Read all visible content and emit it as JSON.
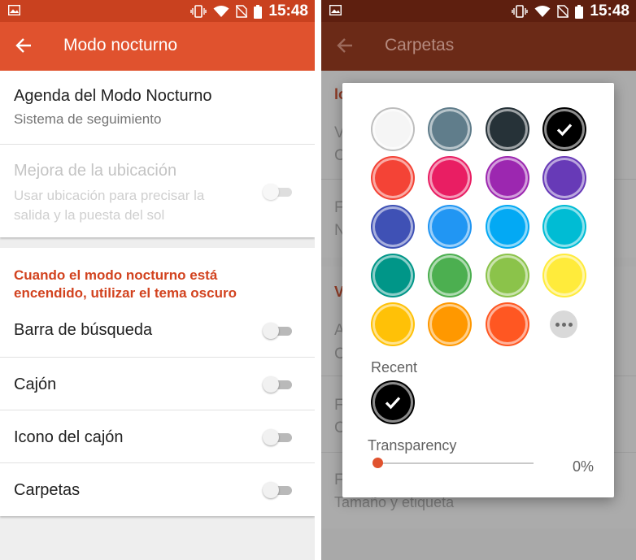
{
  "status_bar": {
    "time": "15:48"
  },
  "left_screen": {
    "title": "Modo nocturno",
    "schedule": {
      "title": "Agenda del Modo Nocturno",
      "subtitle": "Sistema de seguimiento"
    },
    "location": {
      "title": "Mejora de la ubicación",
      "subtitle_line1": "Usar ubicación para precisar la",
      "subtitle_line2": "salida y la puesta del sol",
      "enabled": false
    },
    "section_header_line1": "Cuando el modo nocturno está",
    "section_header_line2": "encendido, utilizar el tema oscuro",
    "toggles": [
      {
        "label": "Barra de búsqueda",
        "on": false
      },
      {
        "label": "Cajón",
        "on": false
      },
      {
        "label": "Icono del cajón",
        "on": false
      },
      {
        "label": "Carpetas",
        "on": false
      }
    ]
  },
  "right_screen": {
    "title": "Carpetas",
    "background_fragments": [
      "lo",
      "V",
      "C",
      "F",
      "N",
      "V",
      "A",
      "C",
      "F",
      "C",
      "F",
      "Tamaño y etiqueta"
    ],
    "color_picker": {
      "swatches": [
        "#f5f5f5",
        "#607d8b",
        "#263238",
        "#000000",
        "#f44336",
        "#e91e63",
        "#9c27b0",
        "#673ab7",
        "#3f51b5",
        "#2196f3",
        "#03a9f4",
        "#00bcd4",
        "#009688",
        "#4caf50",
        "#8bc34a",
        "#ffeb3b",
        "#ffc107",
        "#ff9800",
        "#ff5722"
      ],
      "selected_index": 3,
      "more_icon": "more-horizontal-icon",
      "recent_label": "Recent",
      "recent": [
        "#000000"
      ],
      "transparency_label": "Transparency",
      "transparency_value": "0%",
      "transparency_fraction": 0.0
    }
  },
  "colors": {
    "accent": "#e0522e",
    "status_bar": "#c9411f",
    "section_header": "#d2431f"
  }
}
